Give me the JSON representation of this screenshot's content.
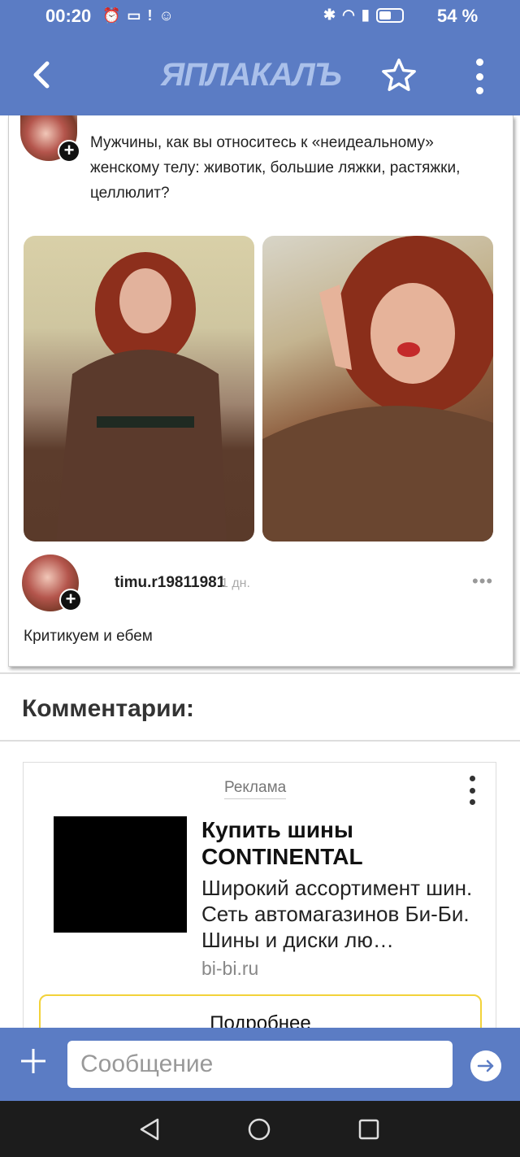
{
  "status_bar": {
    "time": "00:20",
    "battery": "54 %",
    "battery_level": 0.54
  },
  "app_bar": {
    "logo": "ЯПЛАКАЛЪ",
    "back_icon": "chevron-left-icon",
    "favorite_icon": "star-outline-icon",
    "menu_icon": "kebab-menu-icon"
  },
  "post": {
    "question": "Мужчины, как вы относитесь к «неидеальному» женскому телу: животик, большие ляжки, растяжки, целлюлит?",
    "reply_user": "timu.r19811981",
    "reply_time": "1 дн.",
    "reply_more": "•••",
    "reply_text": "Критикуем и ебем"
  },
  "comments": {
    "heading": "Комментарии:"
  },
  "ad": {
    "label": "Реклама",
    "title": "Купить шины CONTINENTAL",
    "description": "Широкий ассортимент шин. Сеть автомагазинов Би-Би. Шины и диски лю…",
    "domain": "bi-bi.ru",
    "button": "Подробнее"
  },
  "message_bar": {
    "placeholder": "Сообщение",
    "add_icon": "plus-icon",
    "send_icon": "send-arrow-icon"
  },
  "colors": {
    "header": "#5b7cc4",
    "ad_button_border": "#f2d23a"
  }
}
